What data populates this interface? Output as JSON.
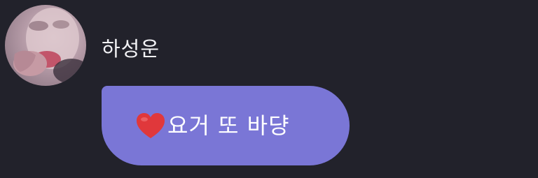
{
  "message": {
    "sender": {
      "name": "하성운",
      "avatar_icon": "profile-photo"
    },
    "bubble": {
      "emoji": "red-heart-icon",
      "text": "요거 또 바댱",
      "color": "#7a76d6"
    }
  },
  "colors": {
    "background": "#22222b",
    "bubble": "#7a76d6",
    "heart": "#e0383b"
  }
}
